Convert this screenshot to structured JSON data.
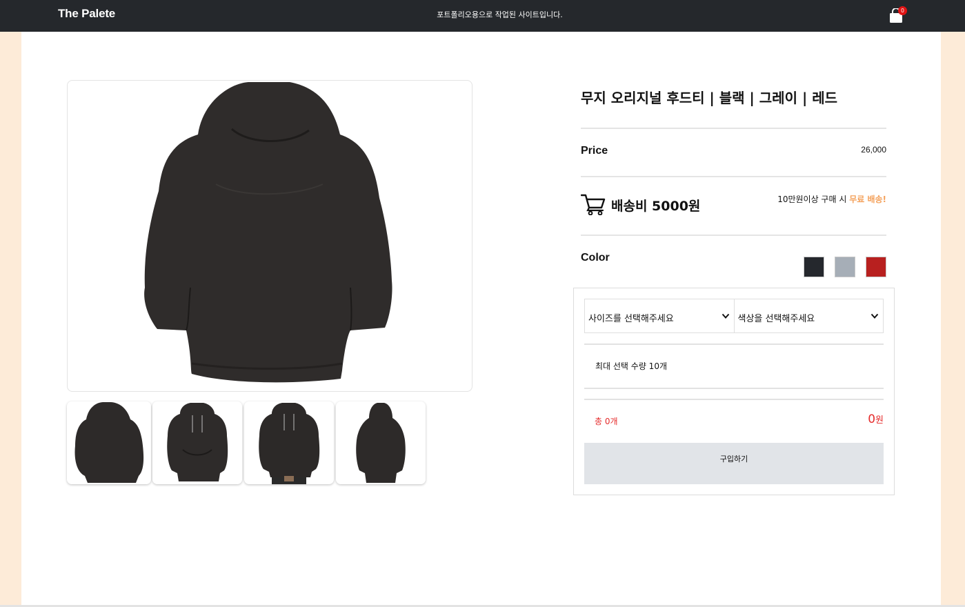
{
  "navbar": {
    "brand": "The Palete",
    "notice": "포트폴리오용으로 작업된 사이트입니다.",
    "cart_count": "0"
  },
  "product": {
    "title": "무지 오리지널 후드티 | 블랙 | 그레이 | 레드",
    "price_label": "Price",
    "price_value": "26,000",
    "shipping_text": "배송비 5000원",
    "free_shipping_prefix": "10만원이상 구매 시 ",
    "free_shipping_accent": "무료 배송!",
    "color_label": "Color",
    "colors": [
      "#25282d",
      "#a6aeb7",
      "#b8201f"
    ]
  },
  "order": {
    "size_placeholder": "사이즈를 선택해주세요",
    "color_placeholder": "색상을 선택해주세요",
    "max_qty": "최대 선택 수량 10개",
    "total_count": "총 0개",
    "total_price": "0",
    "total_unit": "원",
    "buy_label": "구입하기"
  },
  "icons": {
    "cart": "shopping-bag-icon",
    "shipping": "cart-icon",
    "select": "chevron-down-icon"
  }
}
